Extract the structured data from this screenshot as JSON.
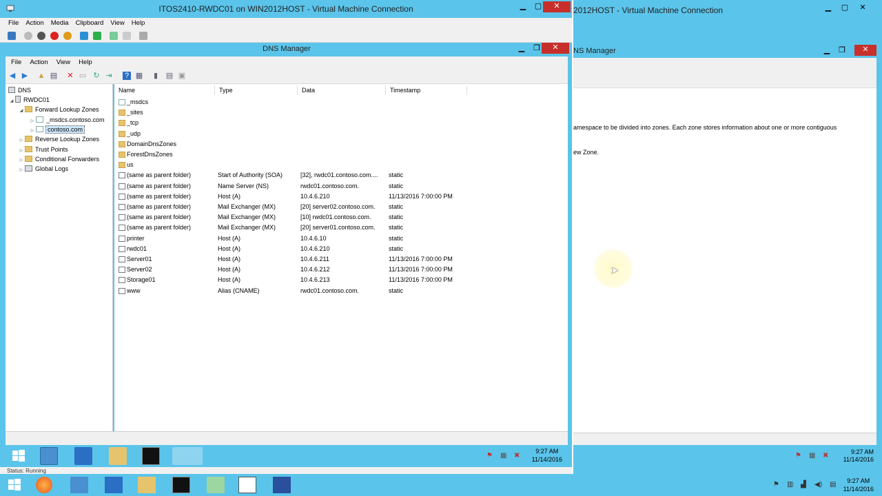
{
  "background_vm": {
    "title": "2012HOST - Virtual Machine Connection",
    "dns_title": "NS Manager",
    "description_line1": "amespace to be divided into zones. Each zone stores information about one or more contiguous",
    "description_line2": "ew Zone.",
    "clock_time": "9:27 AM",
    "clock_date": "11/14/2016"
  },
  "vm_window": {
    "title": "ITOS2410-RWDC01 on WIN2012HOST - Virtual Machine Connection",
    "menu": [
      "File",
      "Action",
      "Media",
      "Clipboard",
      "View",
      "Help"
    ],
    "status": "Status: Running"
  },
  "dns_manager": {
    "title": "DNS Manager",
    "menu": [
      "File",
      "Action",
      "View",
      "Help"
    ],
    "tree": [
      {
        "label": "DNS",
        "level": 0,
        "icon": "dns-icon"
      },
      {
        "label": "RWDC01",
        "level": 1,
        "icon": "server-icon",
        "expanded": true
      },
      {
        "label": "Forward Lookup Zones",
        "level": 2,
        "icon": "folder-icon",
        "expanded": true
      },
      {
        "label": "_msdcs.contoso.com",
        "level": 3,
        "icon": "zone-icon"
      },
      {
        "label": "contoso.com",
        "level": 3,
        "icon": "zone-icon",
        "selected": true
      },
      {
        "label": "Reverse Lookup Zones",
        "level": 2,
        "icon": "folder-icon"
      },
      {
        "label": "Trust Points",
        "level": 2,
        "icon": "folder-icon"
      },
      {
        "label": "Conditional Forwarders",
        "level": 2,
        "icon": "folder-icon"
      },
      {
        "label": "Global Logs",
        "level": 2,
        "icon": "log-icon"
      }
    ],
    "columns": [
      "Name",
      "Type",
      "Data",
      "Timestamp"
    ],
    "rows": [
      {
        "icon": "zone",
        "name": "_msdcs",
        "type": "",
        "data": "",
        "timestamp": ""
      },
      {
        "icon": "folder",
        "name": "_sites",
        "type": "",
        "data": "",
        "timestamp": ""
      },
      {
        "icon": "folder",
        "name": "_tcp",
        "type": "",
        "data": "",
        "timestamp": ""
      },
      {
        "icon": "folder",
        "name": "_udp",
        "type": "",
        "data": "",
        "timestamp": ""
      },
      {
        "icon": "folder",
        "name": "DomainDnsZones",
        "type": "",
        "data": "",
        "timestamp": ""
      },
      {
        "icon": "folder",
        "name": "ForestDnsZones",
        "type": "",
        "data": "",
        "timestamp": ""
      },
      {
        "icon": "folder",
        "name": "us",
        "type": "",
        "data": "",
        "timestamp": ""
      },
      {
        "icon": "record",
        "name": "(same as parent folder)",
        "type": "Start of Authority (SOA)",
        "data": "[32], rwdc01.contoso.com....",
        "timestamp": "static"
      },
      {
        "icon": "record",
        "name": "(same as parent folder)",
        "type": "Name Server (NS)",
        "data": "rwdc01.contoso.com.",
        "timestamp": "static"
      },
      {
        "icon": "record",
        "name": "(same as parent folder)",
        "type": "Host (A)",
        "data": "10.4.6.210",
        "timestamp": "11/13/2016 7:00:00 PM"
      },
      {
        "icon": "record",
        "name": "(same as parent folder)",
        "type": "Mail Exchanger (MX)",
        "data": "[20]  server02.contoso.com.",
        "timestamp": "static"
      },
      {
        "icon": "record",
        "name": "(same as parent folder)",
        "type": "Mail Exchanger (MX)",
        "data": "[10]  rwdc01.contoso.com.",
        "timestamp": "static"
      },
      {
        "icon": "record",
        "name": "(same as parent folder)",
        "type": "Mail Exchanger (MX)",
        "data": "[20]  server01.contoso.com.",
        "timestamp": "static"
      },
      {
        "icon": "record",
        "name": "printer",
        "type": "Host (A)",
        "data": "10.4.6.10",
        "timestamp": "static"
      },
      {
        "icon": "record",
        "name": "rwdc01",
        "type": "Host (A)",
        "data": "10.4.6.210",
        "timestamp": "static"
      },
      {
        "icon": "record",
        "name": "Server01",
        "type": "Host (A)",
        "data": "10.4.6.211",
        "timestamp": "11/13/2016 7:00:00 PM"
      },
      {
        "icon": "record",
        "name": "Server02",
        "type": "Host (A)",
        "data": "10.4.6.212",
        "timestamp": "11/13/2016 7:00:00 PM"
      },
      {
        "icon": "record",
        "name": "Storage01",
        "type": "Host (A)",
        "data": "10.4.6.213",
        "timestamp": "11/13/2016 7:00:00 PM"
      },
      {
        "icon": "record",
        "name": "www",
        "type": "Alias (CNAME)",
        "data": "rwdc01.contoso.com.",
        "timestamp": "static"
      }
    ]
  },
  "guest_taskbar": {
    "clock_time": "9:27 AM",
    "clock_date": "11/14/2016"
  },
  "host_taskbar": {
    "clock_time": "9:27 AM",
    "clock_date": "11/14/2016"
  },
  "colors": {
    "accent": "#5bc4ea",
    "close": "#c7302a",
    "folder": "#e6c46e"
  }
}
